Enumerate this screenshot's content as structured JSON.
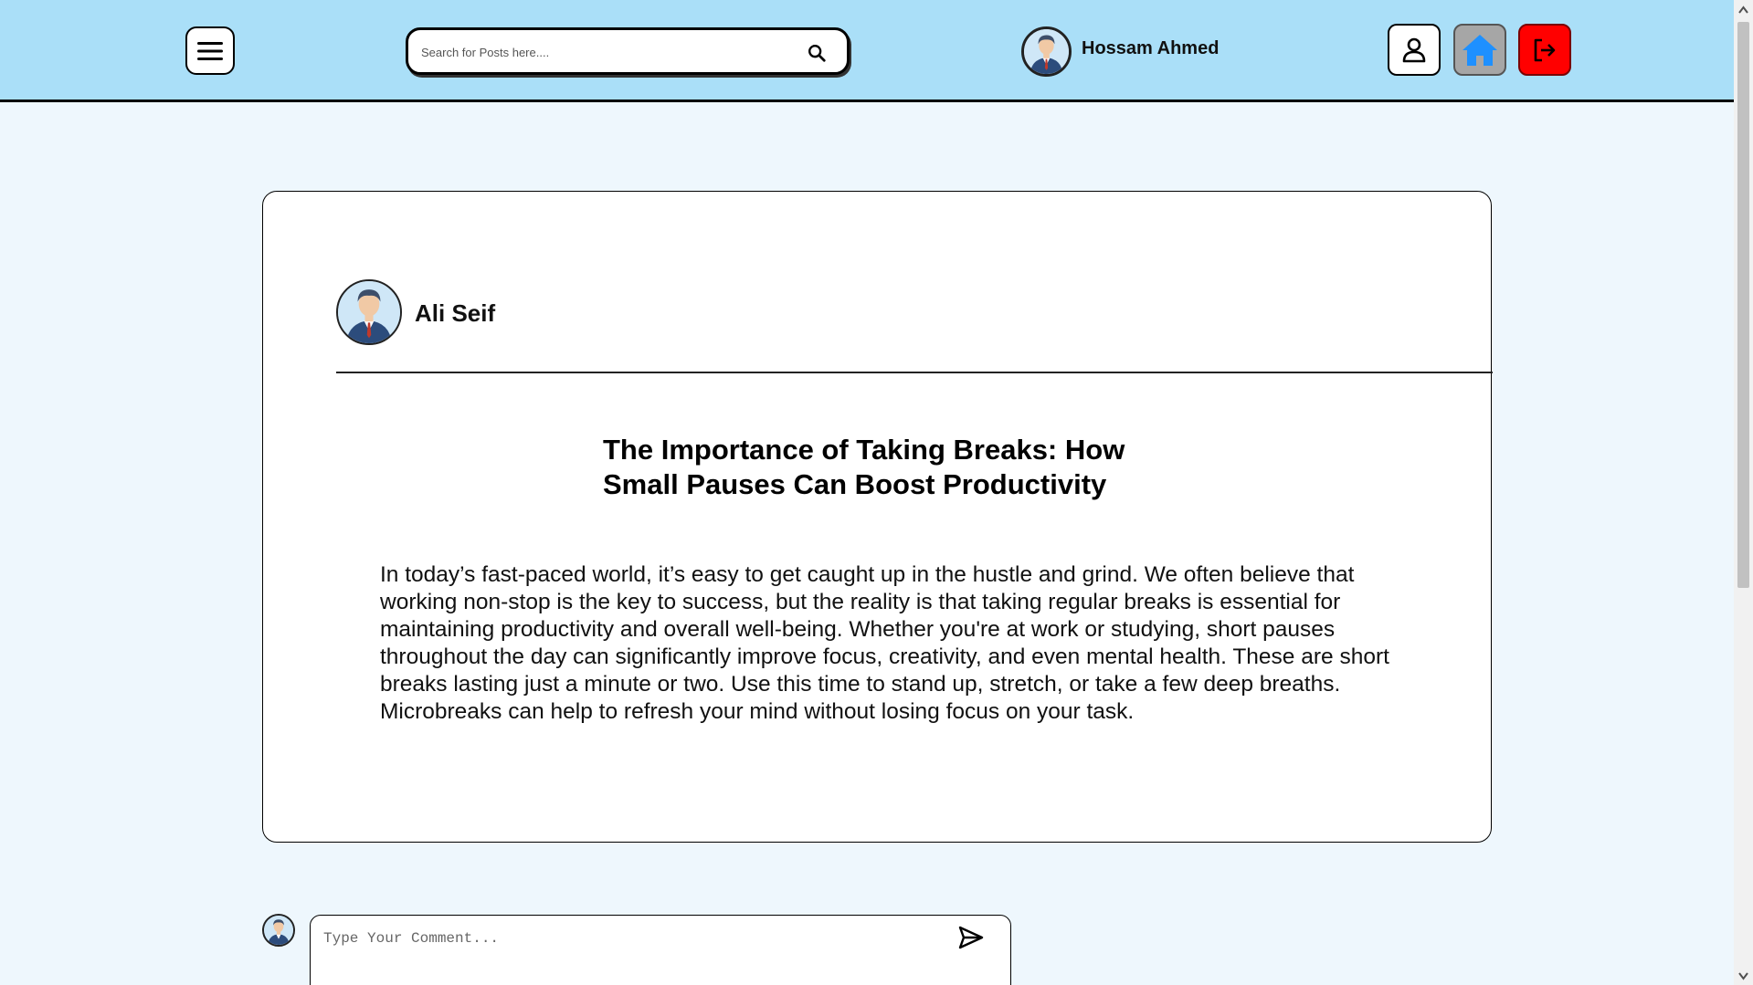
{
  "header": {
    "search": {
      "placeholder": "Search for Posts here....",
      "value": ""
    },
    "user": {
      "name": "Hossam Ahmed"
    },
    "icons": {
      "menu": "hamburger-menu-icon",
      "search": "magnifier-icon",
      "profile": "user-outline-icon",
      "home": "house-icon",
      "logout": "exit-icon"
    },
    "colors": {
      "background": "#aadff8",
      "home_icon": "#1e90ff",
      "logout_button": "#ff0000"
    }
  },
  "post": {
    "author": "Ali Seif",
    "title": "The Importance of Taking Breaks: How Small Pauses Can Boost Productivity",
    "body": "In today’s fast-paced world, it’s easy to get caught up in the hustle and grind. We often believe that working non-stop is the key to success, but the reality is that taking regular breaks is essential for maintaining productivity and overall well-being. Whether you're at work or studying, short pauses throughout the day can significantly improve focus, creativity, and even mental health. These are short breaks lasting just a minute or two. Use this time to stand up, stretch, or take a few deep breaths. Microbreaks can help to refresh your mind without losing focus on your task."
  },
  "comment": {
    "placeholder": "Type Your Comment...",
    "value": "",
    "send_icon": "paper-plane-icon"
  }
}
